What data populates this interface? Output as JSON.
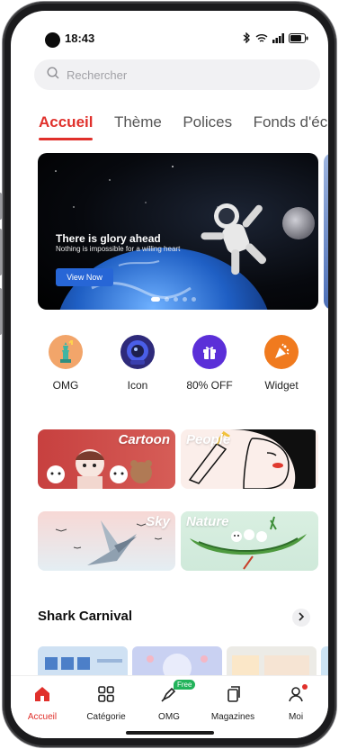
{
  "status_bar": {
    "time": "18:43"
  },
  "search": {
    "placeholder": "Rechercher"
  },
  "tabs": [
    {
      "label": "Accueil",
      "active": true
    },
    {
      "label": "Thème",
      "active": false
    },
    {
      "label": "Polices",
      "active": false
    },
    {
      "label": "Fonds d'écr",
      "active": false
    }
  ],
  "banner": {
    "title": "There is glory ahead",
    "subtitle": "Nothing is impossible for a willing heart",
    "button": "View Now",
    "pages": 5,
    "current_page": 1
  },
  "quick_links": [
    {
      "label": "OMG",
      "icon": "statue-of-liberty-icon",
      "color": "#f2a56a"
    },
    {
      "label": "Icon",
      "icon": "astronaut-avatar-icon",
      "color": "#2e2a7a"
    },
    {
      "label": "80% OFF",
      "icon": "gift-icon",
      "color": "#5b2fd8"
    },
    {
      "label": "Widget",
      "icon": "party-popper-icon",
      "color": "#f07a1e"
    }
  ],
  "categories": [
    {
      "label": "Cartoon"
    },
    {
      "label": "People"
    },
    {
      "label": "Sky"
    },
    {
      "label": "Nature"
    }
  ],
  "section": {
    "title": "Shark Carnival"
  },
  "bottom_nav": [
    {
      "label": "Accueil",
      "icon": "home-icon",
      "active": true
    },
    {
      "label": "Catégorie",
      "icon": "grid-icon",
      "active": false
    },
    {
      "label": "OMG",
      "icon": "brush-icon",
      "badge": "Free",
      "active": false
    },
    {
      "label": "Magazines",
      "icon": "pages-icon",
      "active": false
    },
    {
      "label": "Moi",
      "icon": "profile-icon",
      "active": false,
      "dot": true
    }
  ],
  "colors": {
    "accent": "#e0302b",
    "free_badge": "#22b35a",
    "banner_button": "#2766d6"
  }
}
